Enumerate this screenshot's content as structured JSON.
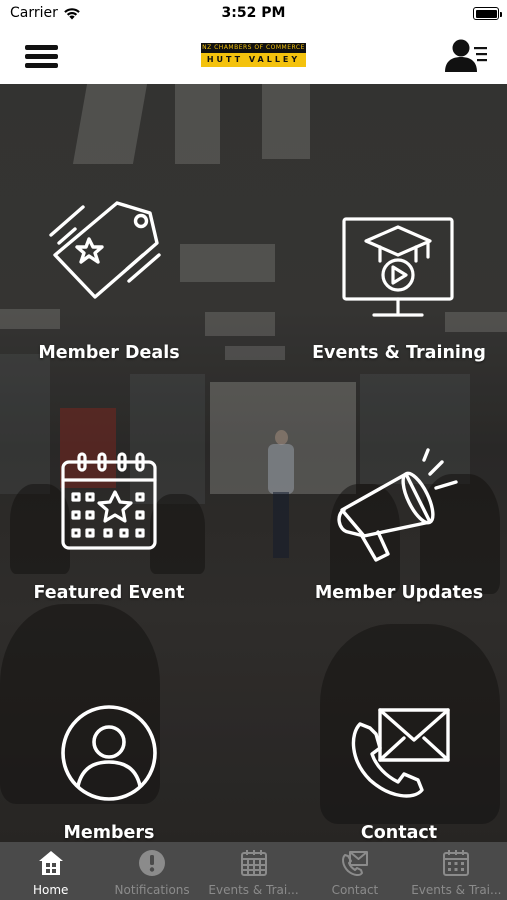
{
  "status_bar": {
    "carrier": "Carrier",
    "time": "3:52 PM"
  },
  "header": {
    "logo_top_text": "NZ CHAMBERS OF COMMERCE",
    "logo_bottom_text": "HUTT VALLEY",
    "logo_colors": {
      "dark": "#111111",
      "accent": "#f4c20d"
    },
    "menu_icon": "hamburger-icon",
    "profile_icon": "user-profile-list-icon"
  },
  "tiles": [
    {
      "label": "Member Deals",
      "icon": "tag-star-icon"
    },
    {
      "label": "Events & Training",
      "icon": "monitor-graduation-cap-icon"
    },
    {
      "label": "Featured Event",
      "icon": "calendar-star-icon"
    },
    {
      "label": "Member Updates",
      "icon": "megaphone-icon"
    },
    {
      "label": "Members",
      "icon": "user-circle-icon"
    },
    {
      "label": "Contact",
      "icon": "phone-envelope-icon"
    }
  ],
  "tab_bar": {
    "background": "#4a4a4a",
    "active_color": "#ffffff",
    "inactive_color": "#8b8b8b",
    "tabs": [
      {
        "label": "Home",
        "icon": "home-icon",
        "active": true
      },
      {
        "label": "Notifications",
        "icon": "alert-circle-icon",
        "active": false
      },
      {
        "label": "Events & Trai...",
        "icon": "calendar-grid-icon",
        "active": false
      },
      {
        "label": "Contact",
        "icon": "phone-envelope-icon",
        "active": false
      },
      {
        "label": "Events & Trai...",
        "icon": "calendar-dots-icon",
        "active": false
      }
    ]
  }
}
